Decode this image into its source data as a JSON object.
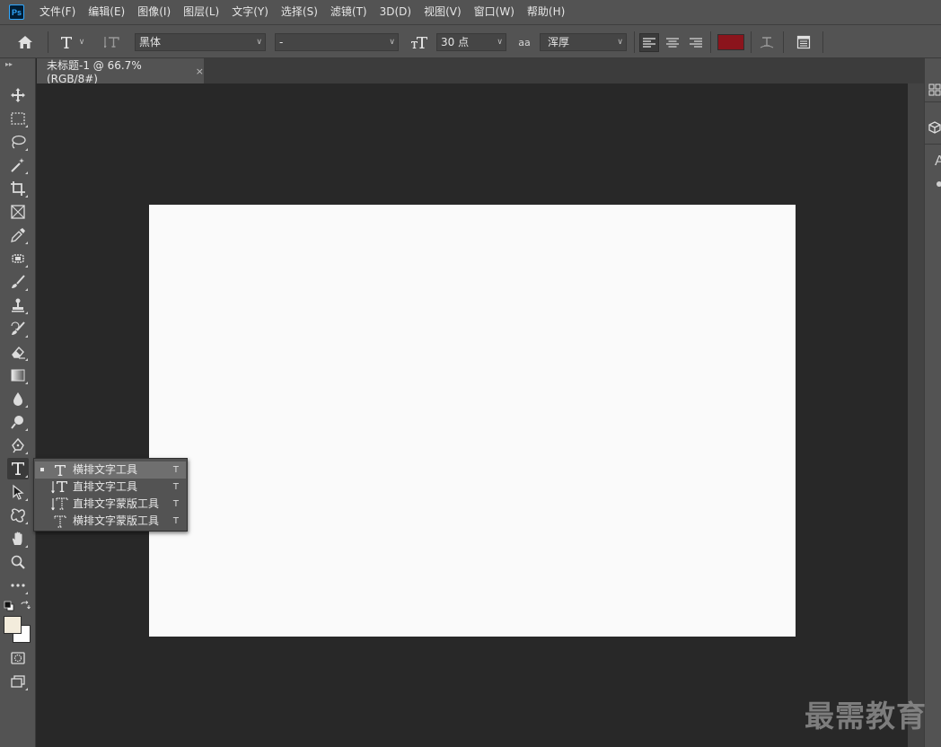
{
  "app": {
    "logo_text": "Ps"
  },
  "menu": [
    "文件(F)",
    "编辑(E)",
    "图像(I)",
    "图层(L)",
    "文字(Y)",
    "选择(S)",
    "滤镜(T)",
    "3D(D)",
    "视图(V)",
    "窗口(W)",
    "帮助(H)"
  ],
  "options": {
    "font_family": "黑体",
    "font_style": "-",
    "font_size": "30 点",
    "antialias_icon": "aa",
    "antialias": "浑厚",
    "text_color": "#8b141c"
  },
  "document": {
    "tab_title": "未标题-1 @ 66.7%(RGB/8#)",
    "close_glyph": "×",
    "canvas_color": "#fafafa"
  },
  "toolbar": {
    "tools": [
      "move-tool",
      "marquee-tool",
      "lasso-tool",
      "magic-wand-tool",
      "crop-tool",
      "frame-tool",
      "eyedropper-tool",
      "healing-tool",
      "brush-tool",
      "stamp-tool",
      "history-brush-tool",
      "eraser-tool",
      "gradient-tool",
      "blur-tool",
      "dodge-tool",
      "pen-tool",
      "type-tool",
      "path-select-tool",
      "shape-tool",
      "hand-tool",
      "zoom-tool",
      "more-tools"
    ],
    "active_tool": "type-tool",
    "foreground_color": "#f3ecdc",
    "background_color": "#ffffff"
  },
  "type_flyout": {
    "items": [
      {
        "label": "横排文字工具",
        "shortcut": "T",
        "selected": true,
        "icon": "horizontal-type-icon"
      },
      {
        "label": "直排文字工具",
        "shortcut": "T",
        "selected": false,
        "icon": "vertical-type-icon"
      },
      {
        "label": "直排文字蒙版工具",
        "shortcut": "T",
        "selected": false,
        "icon": "vertical-type-mask-icon"
      },
      {
        "label": "横排文字蒙版工具",
        "shortcut": "T",
        "selected": false,
        "icon": "horizontal-type-mask-icon"
      }
    ]
  },
  "right_panel": {
    "letter": "A"
  },
  "watermark": "最需教育"
}
